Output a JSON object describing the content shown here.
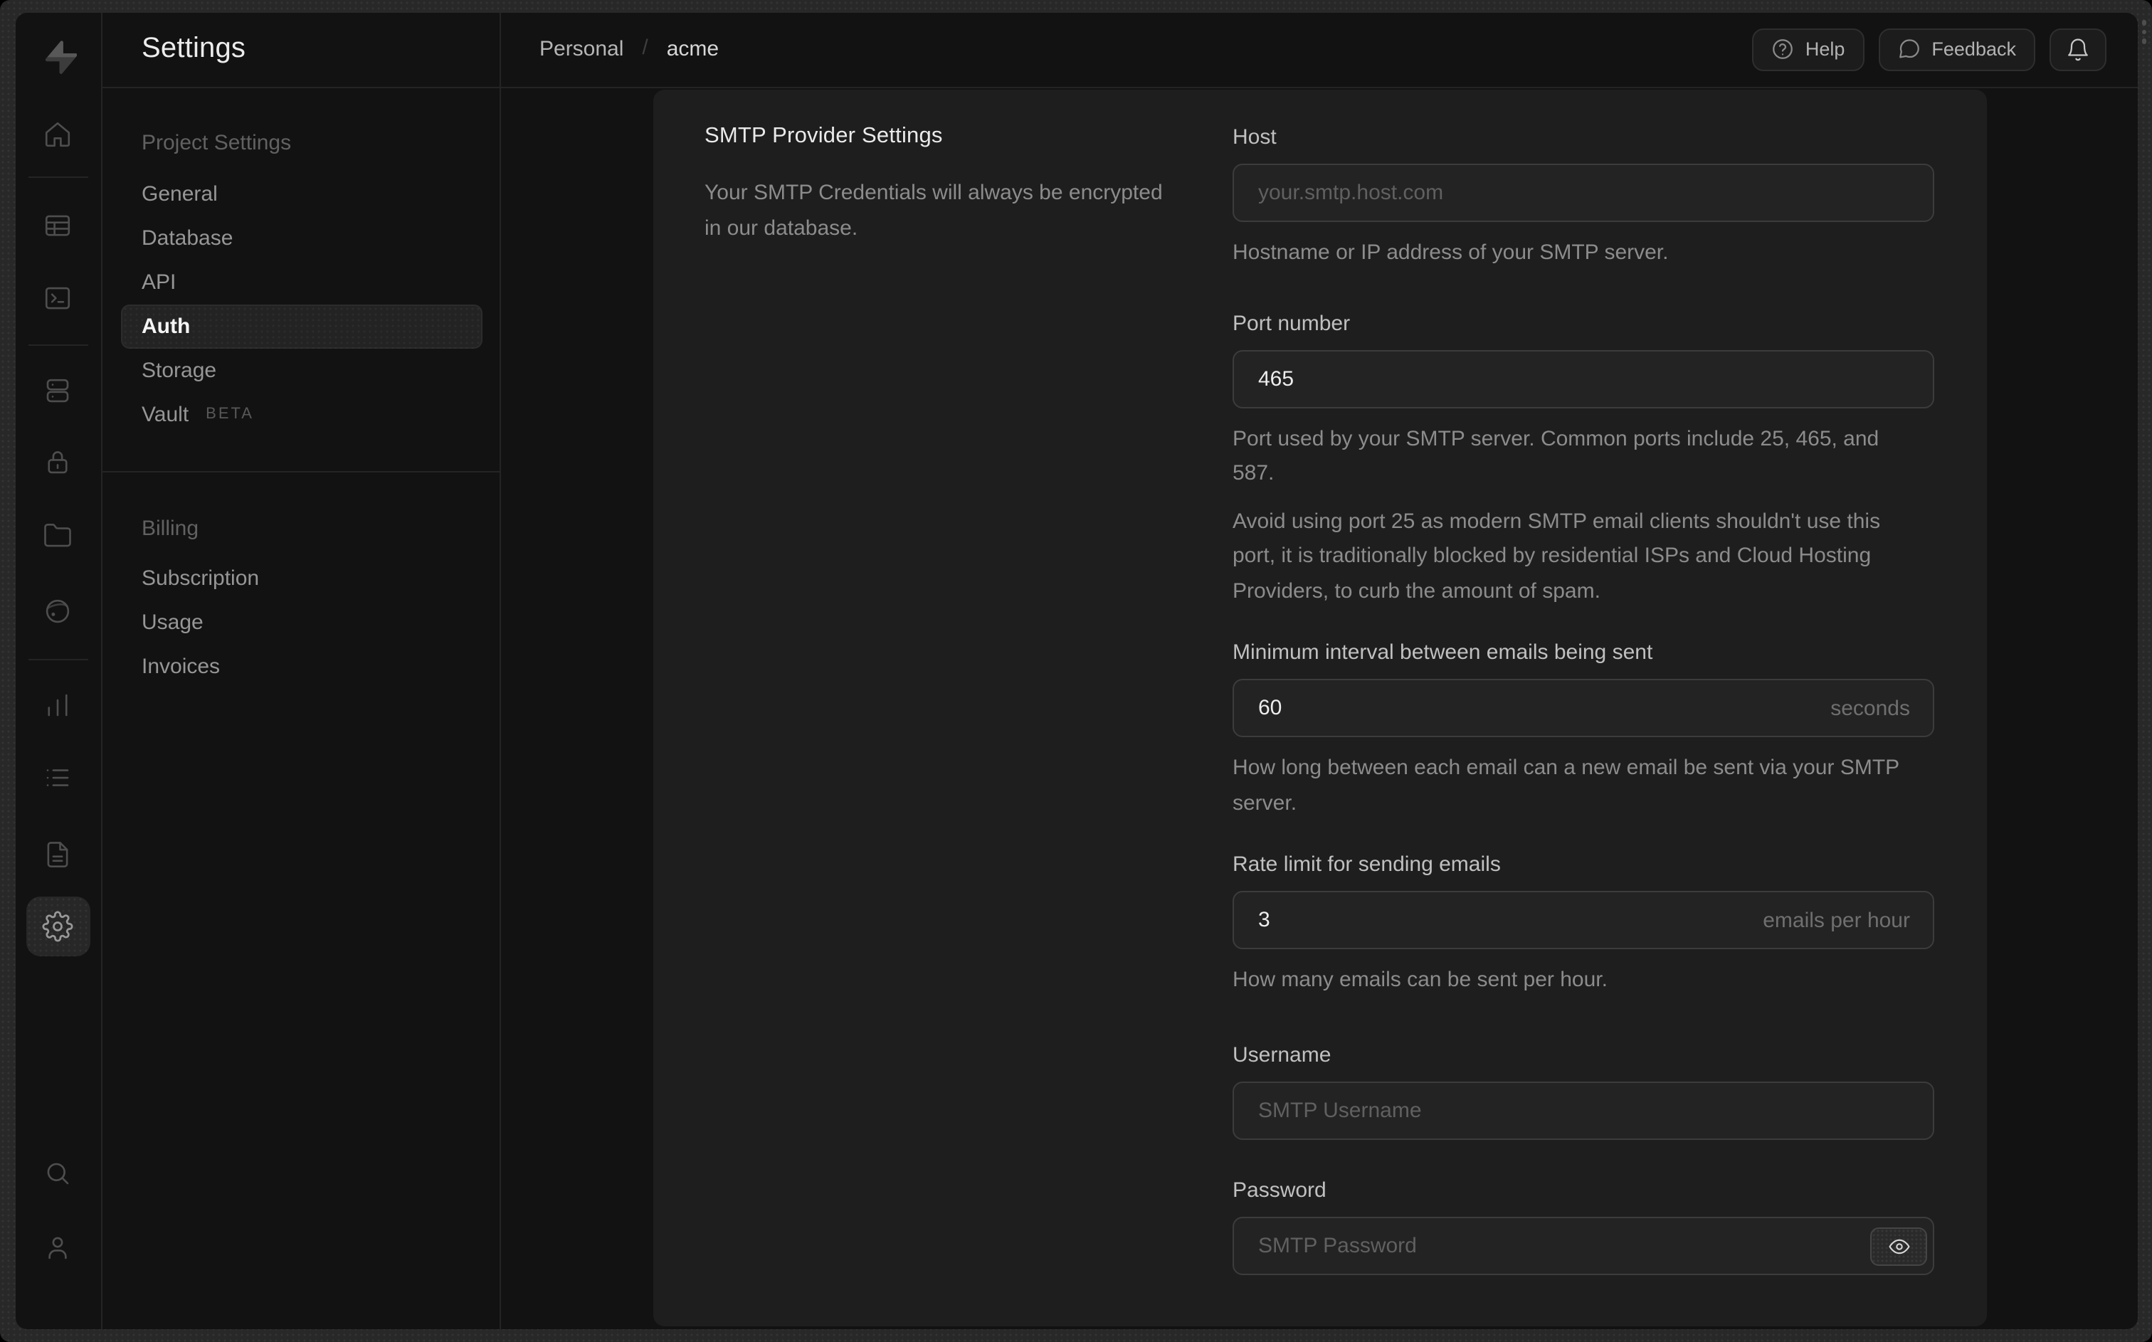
{
  "window": {
    "frame_color": "#282828",
    "app_background": "#121212",
    "card_background": "#1e1e1e"
  },
  "rail": {
    "logo_icon": "supabase-bolt-icon",
    "items": [
      {
        "icon": "home-icon"
      },
      {
        "icon": "table-editor-icon"
      },
      {
        "icon": "sql-editor-icon"
      },
      {
        "icon": "database-icon"
      },
      {
        "icon": "auth-lock-icon"
      },
      {
        "icon": "storage-folder-icon"
      },
      {
        "icon": "realtime-icon"
      },
      {
        "icon": "reports-chart-icon"
      },
      {
        "icon": "logs-list-icon"
      },
      {
        "icon": "api-docs-file-icon"
      },
      {
        "icon": "settings-gear-icon",
        "active": true
      },
      {
        "icon": "search-icon"
      },
      {
        "icon": "profile-user-icon"
      }
    ]
  },
  "nav": {
    "title": "Settings",
    "groups": [
      {
        "label": "Project Settings",
        "items": [
          {
            "label": "General"
          },
          {
            "label": "Database"
          },
          {
            "label": "API"
          },
          {
            "label": "Auth",
            "active": true
          },
          {
            "label": "Storage"
          },
          {
            "label": "Vault",
            "badge": "BETA"
          }
        ]
      },
      {
        "label": "Billing",
        "items": [
          {
            "label": "Subscription"
          },
          {
            "label": "Usage"
          },
          {
            "label": "Invoices"
          }
        ]
      }
    ]
  },
  "header": {
    "breadcrumb": {
      "org": "Personal",
      "separator": "/",
      "project": "acme"
    },
    "actions": {
      "help": "Help",
      "feedback": "Feedback"
    }
  },
  "panel": {
    "title": "SMTP Provider Settings",
    "description": "Your SMTP Credentials will always be encrypted in our database."
  },
  "form": {
    "host": {
      "label": "Host",
      "placeholder": "your.smtp.host.com",
      "helper": "Hostname or IP address of your SMTP server."
    },
    "port": {
      "label": "Port number",
      "value": "465",
      "helper": "Port used by your SMTP server. Common ports include 25, 465, and 587.",
      "helper2": "Avoid using port 25 as modern SMTP email clients shouldn't use this port, it is traditionally blocked by residential ISPs and Cloud Hosting Providers, to curb the amount of spam."
    },
    "interval": {
      "label": "Minimum interval between emails being sent",
      "value": "60",
      "unit": "seconds",
      "helper": "How long between each email can a new email be sent via your SMTP server."
    },
    "rate": {
      "label": "Rate limit for sending emails",
      "value": "3",
      "unit": "emails per hour",
      "helper": "How many emails can be sent per hour."
    },
    "username": {
      "label": "Username",
      "placeholder": "SMTP Username"
    },
    "password": {
      "label": "Password",
      "placeholder": "SMTP Password"
    }
  }
}
